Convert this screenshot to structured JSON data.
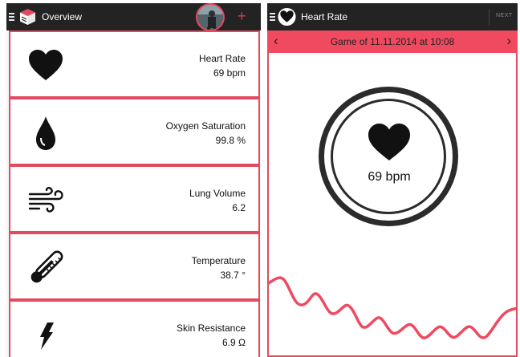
{
  "overview": {
    "title": "Overview",
    "rows": [
      {
        "label": "Heart Rate",
        "value": "69 bpm",
        "icon": "heart-icon"
      },
      {
        "label": "Oxygen Saturation",
        "value": "99.8 %",
        "icon": "drop-icon"
      },
      {
        "label": "Lung Volume",
        "value": "6.2",
        "icon": "wind-icon"
      },
      {
        "label": "Temperature",
        "value": "38.7 °",
        "icon": "thermometer-icon"
      },
      {
        "label": "Skin Resistance",
        "value": "6.9 Ω",
        "icon": "lightning-icon"
      }
    ]
  },
  "detail": {
    "title": "Heart Rate",
    "next_label": "NEXT",
    "game_title": "Game of 11.11.2014 at 10:08",
    "prev_arrow": "‹",
    "next_arrow": "›",
    "reading": "69 bpm"
  },
  "colors": {
    "accent": "#e34a5f",
    "topbar": "#232323"
  }
}
